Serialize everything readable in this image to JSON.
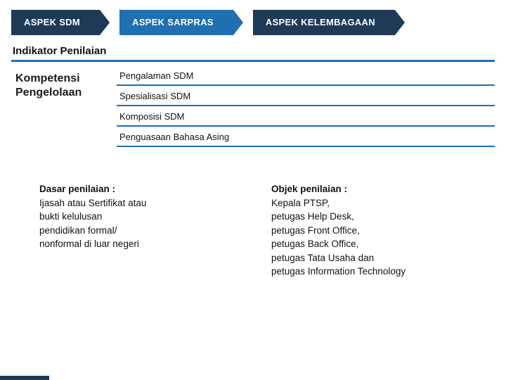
{
  "tabs": {
    "t0": "ASPEK SDM",
    "t1": "ASPEK SARPRAS",
    "t2": "ASPEK KELEMBAGAAN"
  },
  "section_title": "Indikator Penilaian",
  "kompetensi": {
    "line1": "Kompetensi",
    "line2": "Pengelolaan"
  },
  "criteria": {
    "c0": "Pengalaman SDM",
    "c1": "Spesialisasi SDM",
    "c2": "Komposisi SDM",
    "c3": "Penguasaan Bahasa Asing"
  },
  "dasar": {
    "heading": "Dasar penilaian :",
    "l1": "Ijasah atau Sertifikat atau",
    "l2": "bukti kelulusan",
    "l3": "pendidikan formal/",
    "l4": "nonformal di luar negeri"
  },
  "objek": {
    "heading": "Objek penilaian :",
    "l1": "Kepala  PTSP,",
    "l2": "petugas  Help Desk,",
    "l3": "petugas  Front Office,",
    "l4": "petugas  Back Office,",
    "l5": "petugas Tata Usaha dan",
    "l6": "petugas  Information Technology"
  }
}
